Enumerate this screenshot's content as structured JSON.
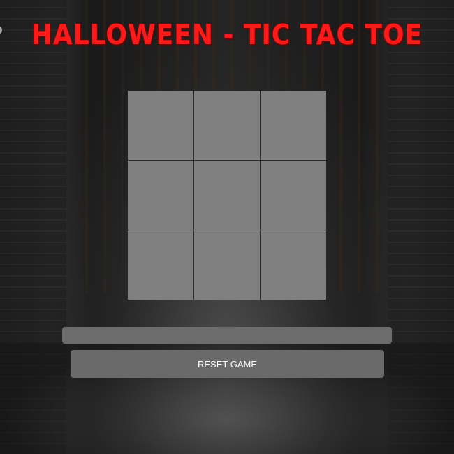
{
  "title": "HALLOWEEN - TIC TAC TOE",
  "board": {
    "cells": [
      "",
      "",
      "",
      "",
      "",
      "",
      "",
      "",
      ""
    ]
  },
  "status_text": "",
  "reset_label": "RESET GAME",
  "colors": {
    "title": "#ff1a1a",
    "cell": "#808080",
    "button": "#6a6a6a",
    "status_bar": "#6c6c6c"
  }
}
